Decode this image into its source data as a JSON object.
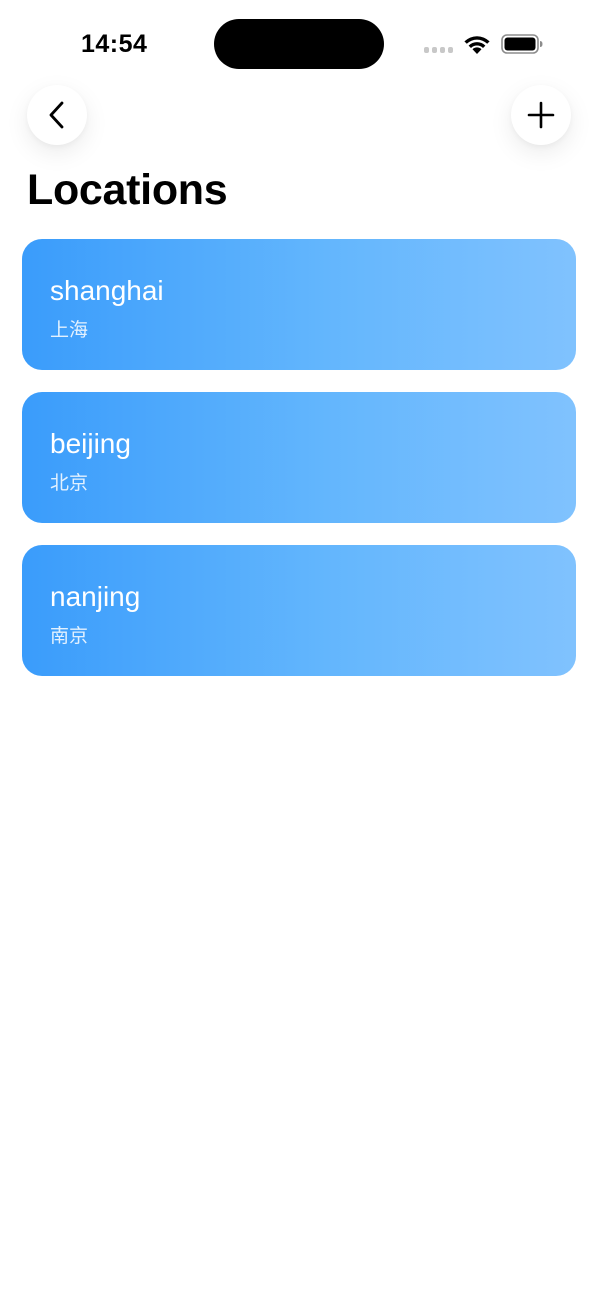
{
  "status_bar": {
    "time": "14:54"
  },
  "nav": {
    "back_icon": "chevron-left-icon",
    "add_icon": "plus-icon"
  },
  "page": {
    "title": "Locations"
  },
  "locations": [
    {
      "name": "shanghai",
      "name_cn": "上海"
    },
    {
      "name": "beijing",
      "name_cn": "北京"
    },
    {
      "name": "nanjing",
      "name_cn": "南京"
    }
  ],
  "colors": {
    "card_gradient_start": "#3a9cfb",
    "card_gradient_end": "#80c2fe",
    "background": "#ffffff"
  }
}
